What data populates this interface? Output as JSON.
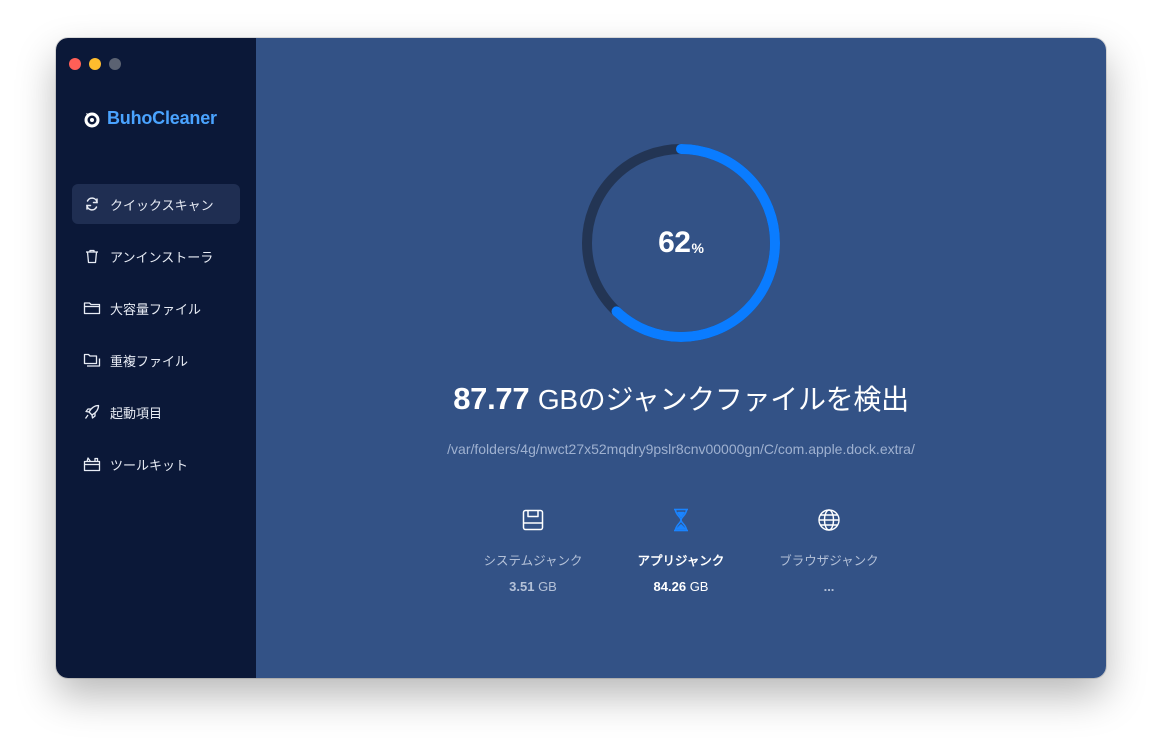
{
  "window": {
    "traffic_colors": [
      "#ff5f57",
      "#febc2e",
      "#5b6272"
    ]
  },
  "brand": {
    "name": "BuhoCleaner",
    "color": "#4aa3ff"
  },
  "sidebar": {
    "items": [
      {
        "label": "クイックスキャン",
        "icon": "refresh-icon",
        "active": true
      },
      {
        "label": "アンインストーラ",
        "icon": "trash-icon"
      },
      {
        "label": "大容量ファイル",
        "icon": "folder-icon"
      },
      {
        "label": "重複ファイル",
        "icon": "duplicate-folder-icon"
      },
      {
        "label": "起動項目",
        "icon": "rocket-icon"
      },
      {
        "label": "ツールキット",
        "icon": "toolkit-icon"
      }
    ]
  },
  "scan": {
    "progress": 0.62,
    "progress_value": "62",
    "progress_unit": "%",
    "accent": "#0a7cff",
    "track": "#233554",
    "found_size": "87.77",
    "found_unit": "GB",
    "found_suffix": "のジャンクファイルを検出",
    "current_path": "/var/folders/4g/nwct27x52mqdry9pslr8cnv00000gn/C/com.apple.dock.extra/"
  },
  "categories": [
    {
      "label": "システムジャンク",
      "value": "3.51",
      "unit": "GB",
      "icon": "disk-icon"
    },
    {
      "label": "アプリジャンク",
      "value": "84.26",
      "unit": "GB",
      "icon": "hourglass-icon",
      "active": true
    },
    {
      "label": "ブラウザジャンク",
      "value": "...",
      "unit": "",
      "icon": "globe-icon"
    }
  ]
}
